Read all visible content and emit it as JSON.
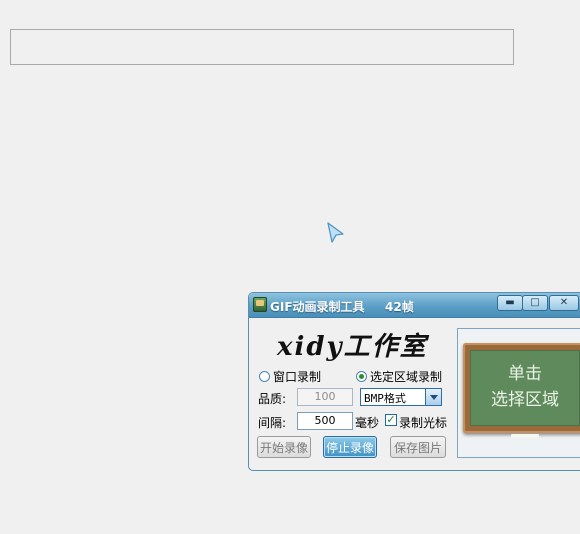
{
  "window": {
    "title": "GIF动画录制工具",
    "frames": "42帧",
    "minimize_glyph": "▬",
    "maximize_glyph": "□",
    "close_glyph": "✕"
  },
  "logo_text": "xidy工作室",
  "modes": {
    "window_record": "窗口录制",
    "region_record": "选定区域录制",
    "selected": "region_record"
  },
  "quality": {
    "label": "品质:",
    "value": "100"
  },
  "format": {
    "selected": "BMP格式"
  },
  "interval": {
    "label": "间隔:",
    "value": "500",
    "unit": "毫秒"
  },
  "record_cursor": {
    "label": "录制光标",
    "checked": true,
    "check_glyph": "✓"
  },
  "buttons": {
    "start": "开始录像",
    "stop": "停止录像",
    "save": "保存图片"
  },
  "board": {
    "line1": "单击",
    "line2": "选择区域"
  },
  "colors": {
    "titlebar": "#5c9fc6",
    "board_green": "#5f8a5c",
    "board_wood": "#9b6a3a"
  },
  "icons": {
    "cursor": "pointer-arrow-icon",
    "app": "app-icon"
  }
}
